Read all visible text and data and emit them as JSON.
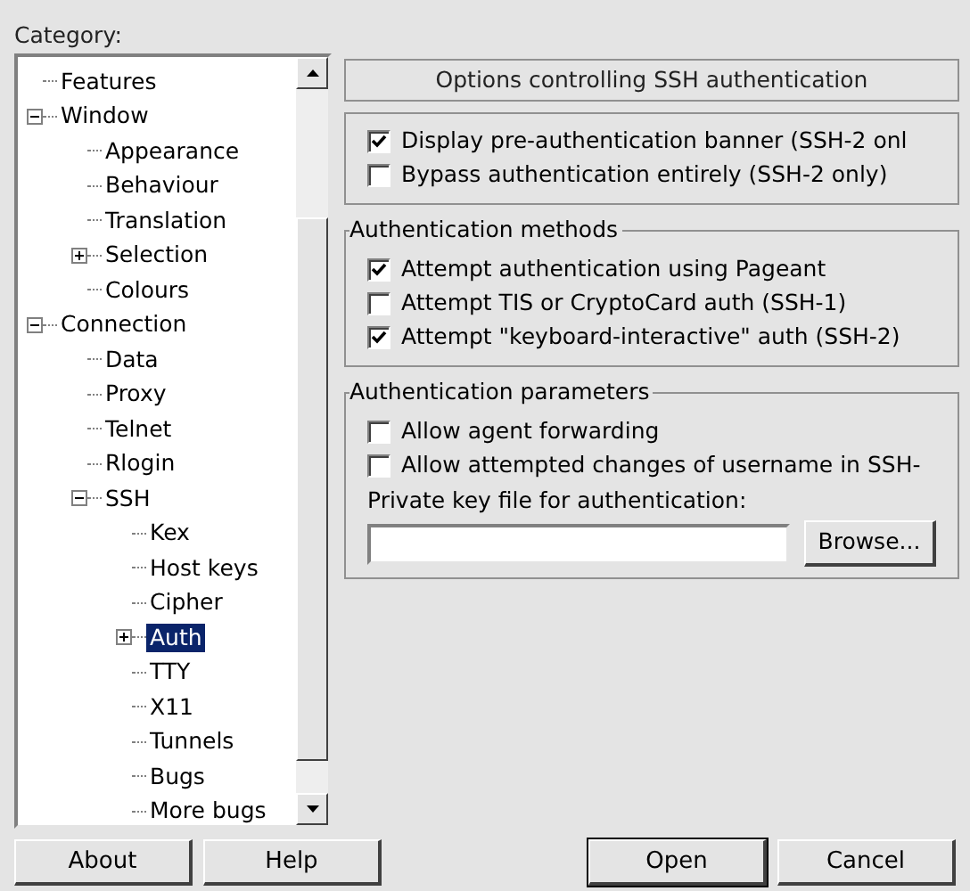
{
  "category_label": "Category:",
  "tree": [
    {
      "children": [
        {
          "label": "Features",
          "selected": false
        }
      ]
    },
    {
      "label": "Window",
      "selected": false,
      "expanded": true,
      "children": [
        {
          "label": "Appearance",
          "selected": false
        },
        {
          "label": "Behaviour",
          "selected": false
        },
        {
          "label": "Translation",
          "selected": false
        },
        {
          "label": "Selection",
          "selected": false,
          "expanded": false
        },
        {
          "label": "Colours",
          "selected": false
        }
      ]
    },
    {
      "label": "Connection",
      "selected": false,
      "expanded": true,
      "children": [
        {
          "label": "Data",
          "selected": false
        },
        {
          "label": "Proxy",
          "selected": false
        },
        {
          "label": "Telnet",
          "selected": false
        },
        {
          "label": "Rlogin",
          "selected": false
        },
        {
          "label": "SSH",
          "selected": false,
          "expanded": true,
          "children": [
            {
              "label": "Kex",
              "selected": false
            },
            {
              "label": "Host keys",
              "selected": false
            },
            {
              "label": "Cipher",
              "selected": false
            },
            {
              "label": "Auth",
              "selected": true,
              "expanded": false
            },
            {
              "label": "TTY",
              "selected": false
            },
            {
              "label": "X11",
              "selected": false
            },
            {
              "label": "Tunnels",
              "selected": false
            },
            {
              "label": "Bugs",
              "selected": false
            },
            {
              "label": "More bugs",
              "selected": false
            }
          ]
        }
      ]
    }
  ],
  "panel_title": "Options controlling SSH authentication",
  "groups": [
    {
      "options": [
        {
          "label": "Display pre-authentication banner (SSH-2 onl",
          "checked": true
        },
        {
          "label": "Bypass authentication entirely (SSH-2 only)",
          "checked": false
        }
      ]
    },
    {
      "title": "Authentication methods",
      "options": [
        {
          "label": "Attempt authentication using Pageant",
          "checked": true
        },
        {
          "label": "Attempt TIS or CryptoCard auth (SSH-1)",
          "checked": false
        },
        {
          "label": "Attempt \"keyboard-interactive\" auth (SSH-2)",
          "checked": true
        }
      ]
    },
    {
      "title": "Authentication parameters",
      "options": [
        {
          "label": "Allow agent forwarding",
          "checked": false
        },
        {
          "label": "Allow attempted changes of username in SSH-",
          "checked": false
        }
      ],
      "key_file": {
        "label": "Private key file for authentication:",
        "button": "Browse..."
      }
    }
  ],
  "buttons_left": [
    "About",
    "Help"
  ],
  "buttons_right": [
    "Open",
    "Cancel"
  ]
}
